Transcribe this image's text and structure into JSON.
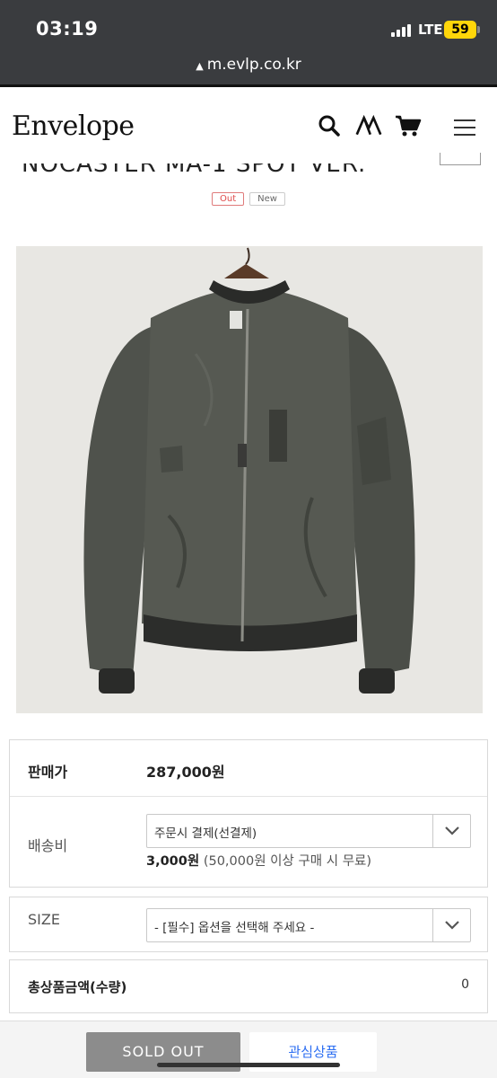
{
  "status_bar": {
    "time": "03:19",
    "network": "LTE",
    "battery": "59"
  },
  "browser": {
    "url": "m.evlp.co.kr"
  },
  "header": {
    "logo": "Envelope"
  },
  "product": {
    "title_partial": "NOCASTER MA-1 SPOT VER.",
    "badges": [
      "Out",
      "New"
    ]
  },
  "info": {
    "price_label": "판매가",
    "price_value": "287,000원",
    "shipping_label": "배송비",
    "shipping_select": "주문시 결제(선결제)",
    "shipping_fee": "3,000원",
    "shipping_note": "(50,000원 이상 구매 시 무료)",
    "size_label": "SIZE",
    "size_select": "- [필수] 옵션을 선택해 주세요 -",
    "total_label": "총상품금액(수량)",
    "total_value": "0"
  },
  "actions": {
    "soldout": "SOLD OUT",
    "wishlist": "관심상품"
  },
  "colors": {
    "statusbar": "#3a3c3f",
    "battery": "#ffd60a",
    "soldout": "#8c8c8c",
    "wish_text": "#2c6ef2",
    "badge_out": "#e04a4a"
  }
}
